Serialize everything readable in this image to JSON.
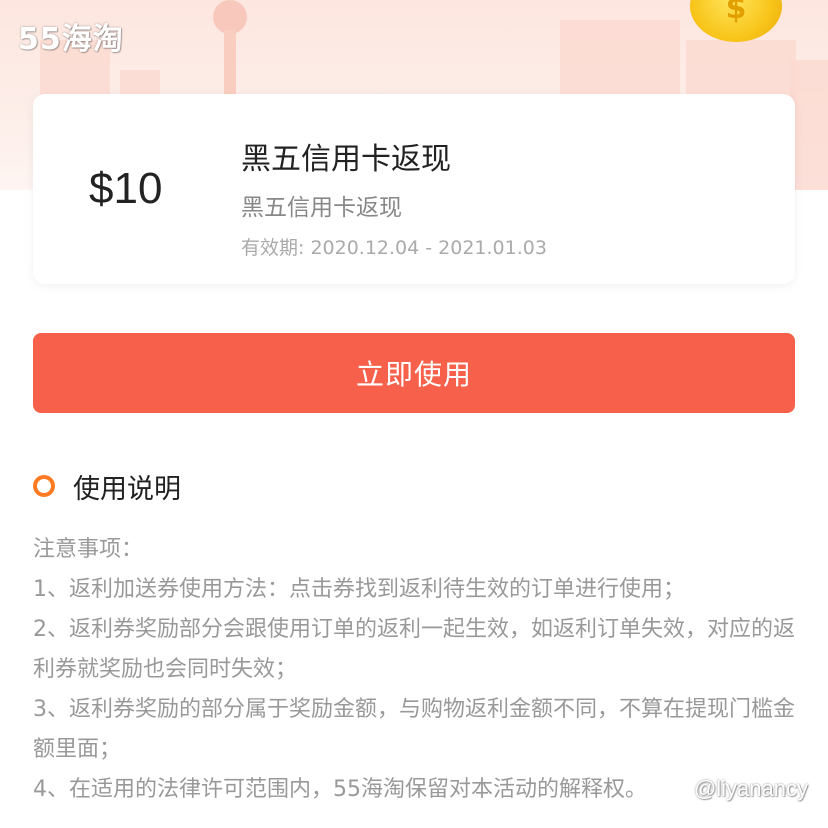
{
  "brand": {
    "logo_text": "55海淘"
  },
  "coupon": {
    "amount": "$10",
    "title": "黑五信用卡返现",
    "subtitle": "黑五信用卡返现",
    "validity": "有效期: 2020.12.04 - 2021.01.03"
  },
  "actions": {
    "use_label": "立即使用"
  },
  "instructions": {
    "heading": "使用说明",
    "notes_title": "注意事项：",
    "items": [
      "1、返利加送券使用方法：点击券找到返利待生效的订单进行使用；",
      "2、返利券奖励部分会跟使用订单的返利一起生效，如返利订单失效，对应的返利券就奖励也会同时失效；",
      "3、返利券奖励的部分属于奖励金额，与购物返利金额不同，不算在提现门槛金额里面；",
      "4、在适用的法律许可范围内，55海淘保留对本活动的解释权。"
    ]
  },
  "watermark": {
    "text": "@liyanancy"
  },
  "colors": {
    "accent": "#f7604a",
    "section_dot": "#ff7a22",
    "banner_bg": "#fde6df",
    "coin": "#f8c51a"
  },
  "icons": {
    "coin": "dollar-coin-icon",
    "section_marker": "ring-dot-icon"
  }
}
